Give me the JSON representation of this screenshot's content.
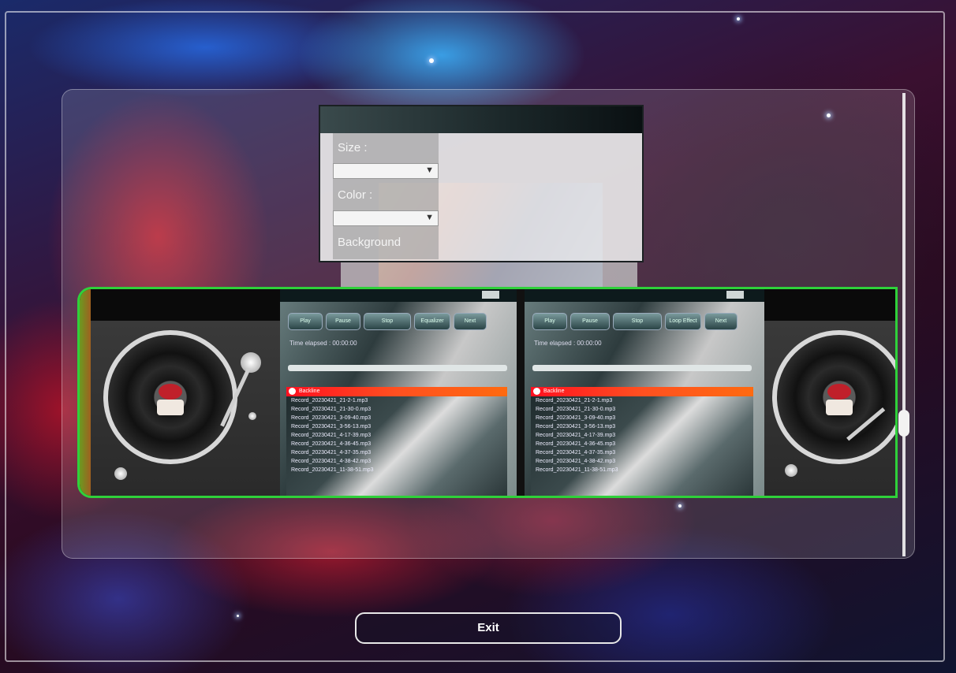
{
  "settings_dialog": {
    "size_label": "Size :",
    "size_value": "",
    "color_label": "Color :",
    "color_value": "",
    "background_label": "Background"
  },
  "deck_left": {
    "buttons": [
      "Play",
      "Pause",
      "Stop",
      "Equalizer",
      "Next"
    ],
    "time_label": "Time elapsed : 00:00:00",
    "now_playing": "Backline",
    "files": [
      "Record_20230421_21-2-1.mp3",
      "Record_20230421_21-30-0.mp3",
      "Record_20230421_3-09-40.mp3",
      "Record_20230421_3-56-13.mp3",
      "Record_20230421_4-17-39.mp3",
      "Record_20230421_4-36-45.mp3",
      "Record_20230421_4-37-35.mp3",
      "Record_20230421_4-38-42.mp3",
      "Record_20230421_11-38-51.mp3"
    ]
  },
  "deck_right": {
    "buttons": [
      "Play",
      "Pause",
      "Stop",
      "Loop Effect",
      "Next"
    ],
    "time_label": "Time elapsed : 00:00:00",
    "now_playing": "Backline",
    "files": [
      "Record_20230421_21-2-1.mp3",
      "Record_20230421_21-30-0.mp3",
      "Record_20230421_3-09-40.mp3",
      "Record_20230421_3-56-13.mp3",
      "Record_20230421_4-17-39.mp3",
      "Record_20230421_4-36-45.mp3",
      "Record_20230421_4-37-35.mp3",
      "Record_20230421_4-38-42.mp3",
      "Record_20230421_11-38-51.mp3"
    ]
  },
  "exit_label": "Exit",
  "colors": {
    "deck_border": "#2fd13a",
    "now_playing_bar": "#ff2a1a"
  }
}
